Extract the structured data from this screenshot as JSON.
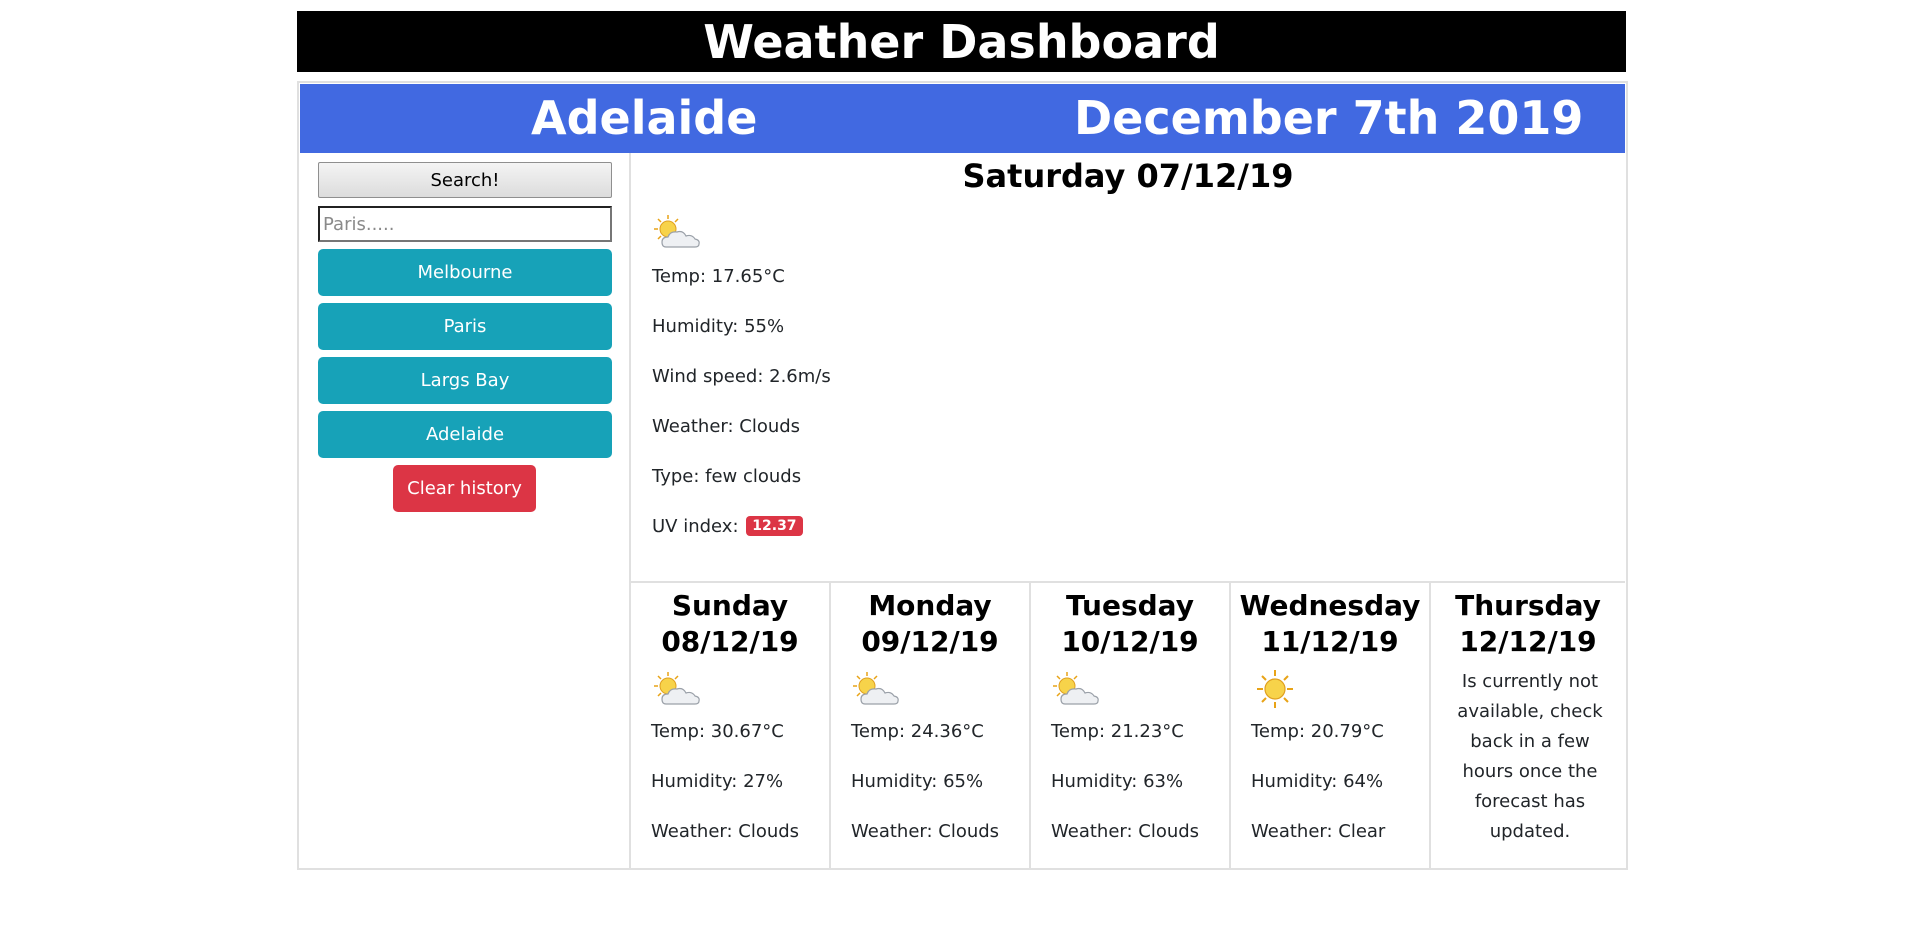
{
  "header": {
    "title": "Weather Dashboard"
  },
  "location": {
    "city": "Adelaide",
    "date": "December 7th 2019"
  },
  "sidebar": {
    "search_label": "Search!",
    "search_placeholder": "Paris.....",
    "history": [
      "Melbourne",
      "Paris",
      "Largs Bay",
      "Adelaide"
    ],
    "clear_label": "Clear history"
  },
  "today": {
    "title": "Saturday 07/12/19",
    "icon": "few-clouds-icon",
    "temp": "Temp: 17.65°C",
    "humidity": "Humidity: 55%",
    "wind": "Wind speed: 2.6m/s",
    "weather": "Weather: Clouds",
    "type": "Type: few clouds",
    "uv_label": "UV index:",
    "uv_value": "12.37"
  },
  "forecast": [
    {
      "day": "Sunday",
      "date": "08/12/19",
      "icon": "few-clouds-icon",
      "temp": "Temp: 30.67°C",
      "humidity": "Humidity: 27%",
      "weather": "Weather: Clouds"
    },
    {
      "day": "Monday",
      "date": "09/12/19",
      "icon": "few-clouds-icon",
      "temp": "Temp: 24.36°C",
      "humidity": "Humidity: 65%",
      "weather": "Weather: Clouds"
    },
    {
      "day": "Tuesday",
      "date": "10/12/19",
      "icon": "few-clouds-icon",
      "temp": "Temp: 21.23°C",
      "humidity": "Humidity: 63%",
      "weather": "Weather: Clouds"
    },
    {
      "day": "Wednesday",
      "date": "11/12/19",
      "icon": "clear-sun-icon",
      "temp": "Temp: 20.79°C",
      "humidity": "Humidity: 64%",
      "weather": "Weather: Clear"
    },
    {
      "day": "Thursday",
      "date": "12/12/19",
      "message": "Is currently not available, check back in a few hours once the forecast has updated."
    }
  ],
  "colors": {
    "header_bg": "#000000",
    "city_bar_bg": "#4169e1",
    "history_button": "#17a2b8",
    "clear_button": "#dc3545",
    "uv_badge": "#dc3545"
  }
}
